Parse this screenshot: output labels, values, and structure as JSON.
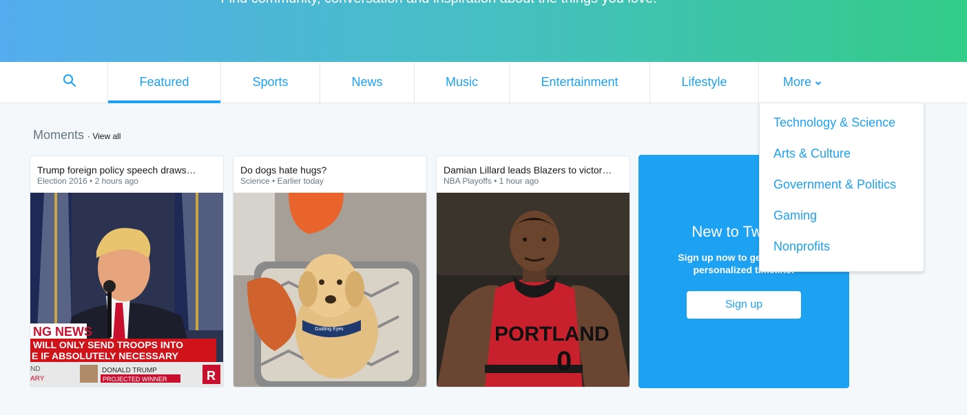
{
  "hero": {
    "tagline": "Find community, conversation and inspiration about the things you love."
  },
  "nav": {
    "search_icon": "search-icon",
    "tabs": [
      {
        "label": "Featured",
        "active": true
      },
      {
        "label": "Sports"
      },
      {
        "label": "News"
      },
      {
        "label": "Music"
      },
      {
        "label": "Entertainment"
      },
      {
        "label": "Lifestyle"
      }
    ],
    "more": {
      "label": "More",
      "icon": "chevron-down-icon"
    }
  },
  "dropdown": {
    "items": [
      "Technology & Science",
      "Arts & Culture",
      "Government & Politics",
      "Gaming",
      "Nonprofits"
    ]
  },
  "moments": {
    "title": "Moments",
    "view_all": "· View all",
    "cards": [
      {
        "title": "Trump foreign policy speech draws…",
        "meta": "Election 2016 • 2 hours ago",
        "overlay": {
          "breaking": "NG NEWS",
          "line1": "WILL ONLY SEND TROOPS INTO",
          "line2": "E IF ABSOLUTELY NECESSARY",
          "name": "DONALD TRUMP",
          "status": "PROJECTED WINNER",
          "edge1": "ND",
          "edge2": "ARY",
          "badge": "R"
        }
      },
      {
        "title": "Do dogs hate hugs?",
        "meta": "Science • Earlier today",
        "overlay": {
          "vest": "Guiding Eyes"
        }
      },
      {
        "title": "Damian Lillard leads Blazers to victor…",
        "meta": "NBA Playoffs • 1 hour ago",
        "overlay": {
          "jersey": "PORTLAND",
          "number": "0"
        }
      }
    ]
  },
  "signup": {
    "title": "New to Twitter?",
    "subtitle": "Sign up now to get your own personalized timeline!",
    "button": "Sign up"
  },
  "colors": {
    "accent": "#1da1f2",
    "gradient_start": "#55acee",
    "gradient_end": "#33cc88"
  }
}
